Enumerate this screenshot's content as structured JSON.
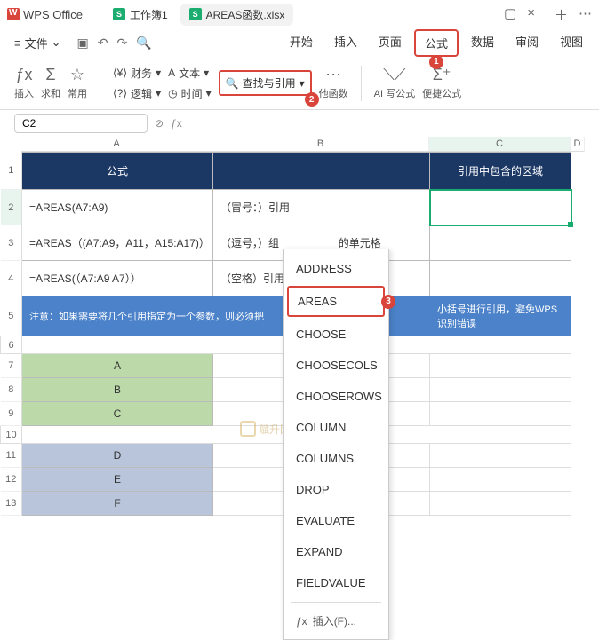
{
  "app": {
    "name": "WPS Office"
  },
  "file_tabs": [
    {
      "icon": "S",
      "label": "工作簿1",
      "active": false
    },
    {
      "icon": "S",
      "label": "AREAS函数.xlsx",
      "active": true
    }
  ],
  "menu": {
    "file": "文件",
    "tabs": [
      "开始",
      "插入",
      "页面",
      "公式",
      "数据",
      "审阅",
      "视图"
    ],
    "active_tab": "公式"
  },
  "ribbon": {
    "insert": "插入",
    "sum": "求和",
    "common": "常用",
    "finance": "财务",
    "text": "文本",
    "logic": "逻辑",
    "time": "时间",
    "lookup": "查找与引用",
    "other": "他函数",
    "ai": "AI 写公式",
    "quick": "便捷公式"
  },
  "namebox": "C2",
  "dropdown": {
    "items": [
      "ADDRESS",
      "AREAS",
      "CHOOSE",
      "CHOOSECOLS",
      "CHOOSEROWS",
      "COLUMN",
      "COLUMNS",
      "DROP",
      "EVALUATE",
      "EXPAND",
      "FIELDVALUE"
    ],
    "highlighted": "AREAS",
    "footer": "插入(F)..."
  },
  "sheet": {
    "headers": {
      "A": "公式",
      "B": "",
      "C": "引用中包含的区域"
    },
    "rows": [
      {
        "A": "=AREAS(A7:A9)",
        "B": "（冒号：）引用"
      },
      {
        "A": "=AREAS（(A7:A9，A11，A15:A17)）",
        "B": "（逗号，）组",
        "Bextra": "的单元格"
      },
      {
        "A": "=AREAS(（A7:A9 A7））",
        "B": "（空格）引用"
      }
    ],
    "note": {
      "left": "注意：如果需要将几个引用指定为一个参数，则必须把",
      "right": "小括号进行引用，避免WPS识别错误"
    },
    "greens": [
      "A",
      "B",
      "C"
    ],
    "blues": [
      "D",
      "E",
      "F"
    ]
  },
  "watermark": "赋升网"
}
